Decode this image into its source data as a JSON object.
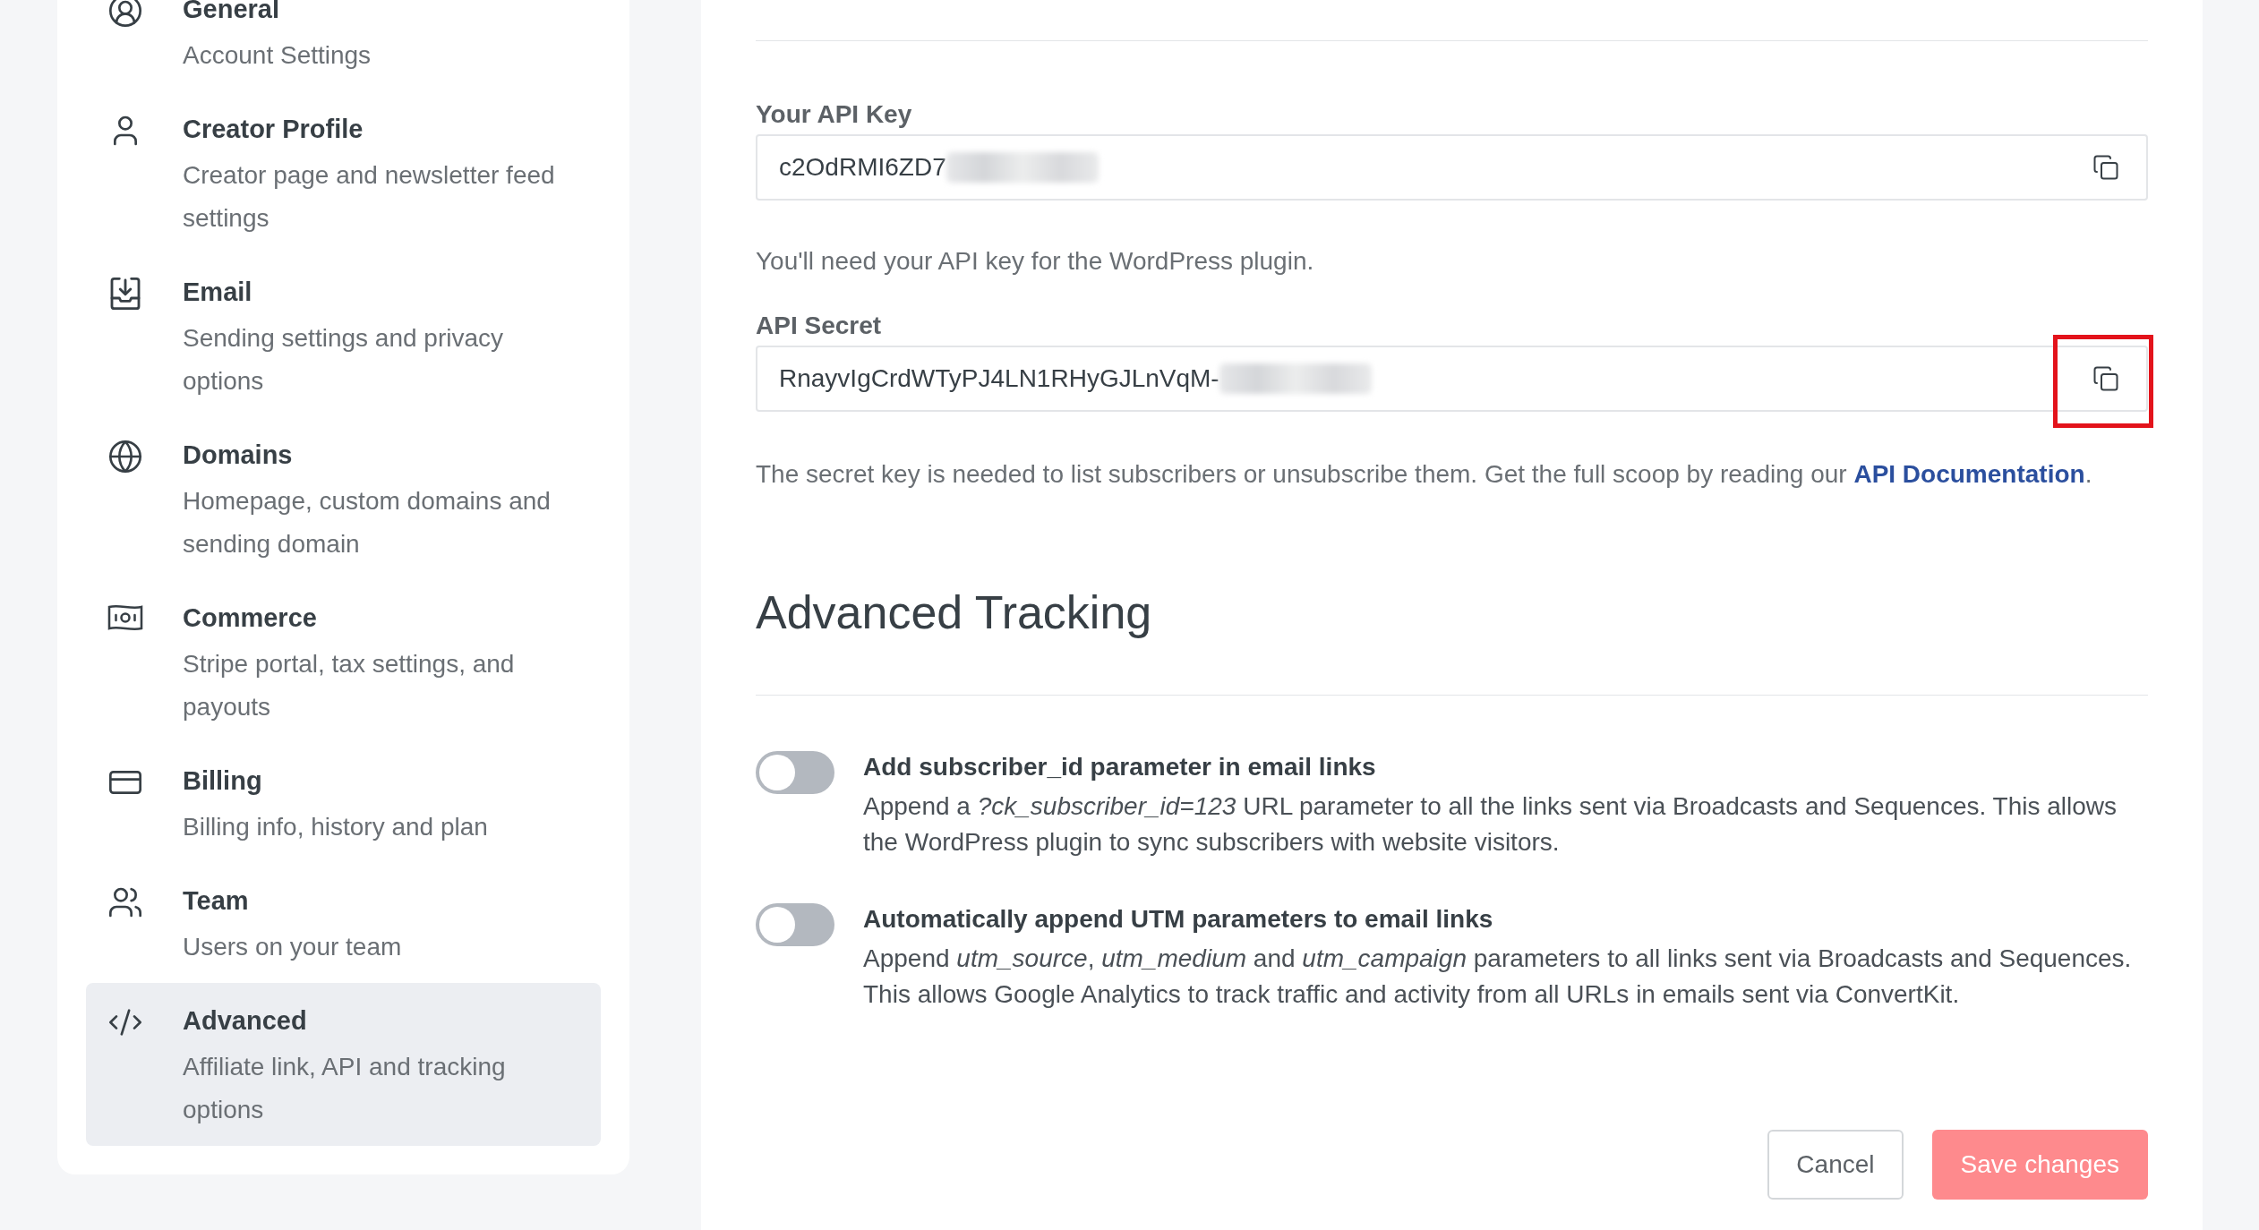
{
  "sidebar": {
    "items": [
      {
        "title": "General",
        "description": "Account Settings",
        "selected": false
      },
      {
        "title": "Creator Profile",
        "description": "Creator page and newsletter feed settings",
        "selected": false
      },
      {
        "title": "Email",
        "description": "Sending settings and privacy options",
        "selected": false
      },
      {
        "title": "Domains",
        "description": "Homepage, custom domains and sending domain",
        "selected": false
      },
      {
        "title": "Commerce",
        "description": "Stripe portal, tax settings, and payouts",
        "selected": false
      },
      {
        "title": "Billing",
        "description": "Billing info, history and plan",
        "selected": false
      },
      {
        "title": "Team",
        "description": "Users on your team",
        "selected": false
      },
      {
        "title": "Advanced",
        "description": "Affiliate link, API and tracking options",
        "selected": true
      }
    ]
  },
  "api": {
    "fields": [
      {
        "label": "Your API Key",
        "value": "c2OdRMI6ZD7",
        "redacted": true,
        "note": "You'll need your API key for the WordPress plugin."
      },
      {
        "label": "API Secret",
        "value": "RnayvIgCrdWTyPJ4LN1RHyGJLnVqM-",
        "redacted": true,
        "highlighted": true,
        "note": "The secret key is needed to list subscribers or unsubscribe them. Get the full scoop by reading our",
        "link": "API Documentation",
        "after_link": "."
      }
    ]
  },
  "tracking": {
    "heading": "Advanced Tracking",
    "toggles": [
      {
        "title": "Add subscriber_id parameter in email links",
        "description": "Append a *?ck_subscriber_id=123* URL parameter to all the links sent via Broadcasts and Sequences. This allows the WordPress plugin to sync subscribers with website visitors.",
        "on": false
      },
      {
        "title": "Automatically append UTM parameters to email links",
        "description": "Append *utm_source*, *utm_medium* and *utm_campaign* parameters to all links sent via Broadcasts and Sequences. This allows Google Analytics to track traffic and activity from all URLs in emails sent via ConvertKit.",
        "on": false
      }
    ]
  },
  "actions": {
    "cancel": "Cancel",
    "save": "Save changes",
    "save_disabled": true
  }
}
